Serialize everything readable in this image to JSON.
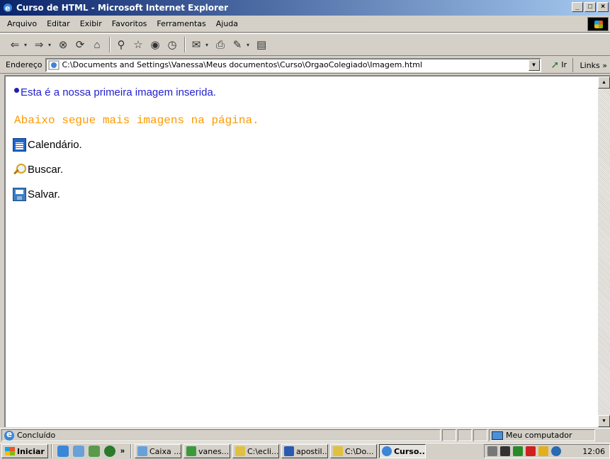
{
  "window": {
    "title": "Curso de HTML - Microsoft Internet Explorer",
    "controls": {
      "minimize": "_",
      "maximize": "□",
      "close": "×"
    }
  },
  "menu": [
    "Arquivo",
    "Editar",
    "Exibir",
    "Favoritos",
    "Ferramentas",
    "Ajuda"
  ],
  "address": {
    "label": "Endereço",
    "value": "C:\\Documents and Settings\\Vanessa\\Meus documentos\\Curso\\OrgaoColegiado\\Imagem.html",
    "go_label": "Ir",
    "links_label": "Links"
  },
  "page": {
    "intro": "Esta é a nossa primeira imagem inserida.",
    "subtitle": "Abaixo segue mais imagens na página.",
    "items": [
      {
        "label": "Calendário.",
        "icon": "calendar-icon"
      },
      {
        "label": "Buscar.",
        "icon": "magnifier-icon"
      },
      {
        "label": "Salvar.",
        "icon": "save-icon"
      }
    ],
    "colors": {
      "intro": "#2222cc",
      "subtitle": "#ff9900"
    }
  },
  "status": {
    "text": "Concluído",
    "zone": "Meu computador"
  },
  "taskbar": {
    "start_label": "Iniciar",
    "tasks": [
      "Caixa ...",
      "vanes...",
      "C:\\ecli...",
      "apostil...",
      "C:\\Do...",
      "Curso..."
    ],
    "clock": "12:06"
  }
}
